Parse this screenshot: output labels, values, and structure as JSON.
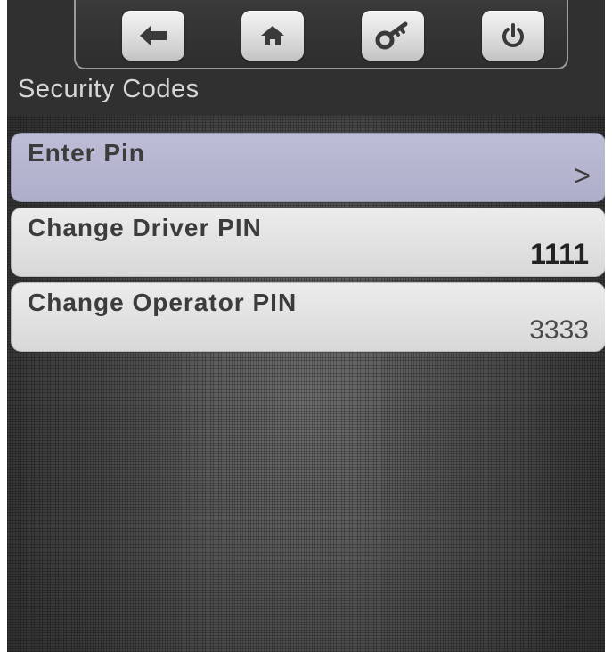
{
  "toolbar": {
    "buttons": [
      {
        "icon": "back-arrow-icon"
      },
      {
        "icon": "home-icon"
      },
      {
        "icon": "key-icon"
      },
      {
        "icon": "power-icon"
      }
    ]
  },
  "page": {
    "title": "Security Codes"
  },
  "menu": {
    "items": [
      {
        "label": "Enter Pin",
        "value": ">"
      },
      {
        "label": "Change Driver PIN",
        "value": "1111"
      },
      {
        "label": "Change Operator PIN",
        "value": "3333"
      }
    ]
  },
  "colors": {
    "selected_item": "#b3b3cf",
    "item": "#e2e2e2",
    "background": "#4a4a4a",
    "title_text": "#d6d6d6"
  }
}
